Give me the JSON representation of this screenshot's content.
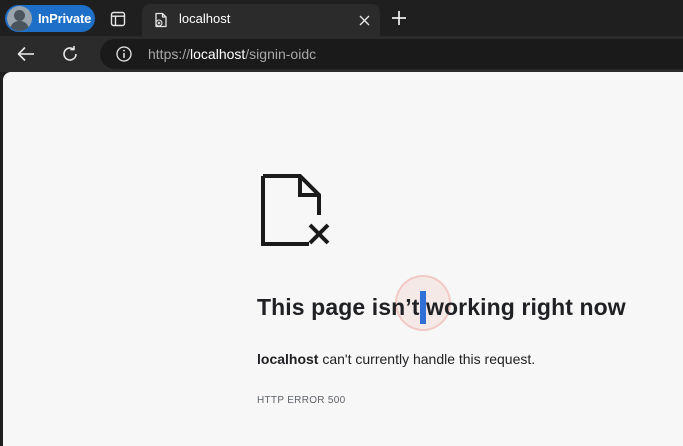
{
  "browser": {
    "profile_label": "InPrivate",
    "tab": {
      "title": "localhost"
    },
    "address": {
      "scheme": "https://",
      "host": "localhost",
      "path": "/signin-oidc"
    }
  },
  "error_page": {
    "heading_part1": "This page isn’t",
    "heading_part2": "working right now",
    "message_host": "localhost",
    "message_text": " can't currently handle this request.",
    "error_code": "HTTP ERROR 500"
  },
  "icons": {
    "avatar": "avatar-icon",
    "tab_actions": "tab-actions-icon",
    "favicon": "page-document-icon",
    "close": "close-icon",
    "new_tab": "plus-icon",
    "back": "back-arrow-icon",
    "refresh": "refresh-icon",
    "info": "info-icon",
    "error": "broken-document-icon"
  },
  "colors": {
    "inprivate_accent": "#1d6fc8",
    "caret": "#2f6fd6"
  }
}
